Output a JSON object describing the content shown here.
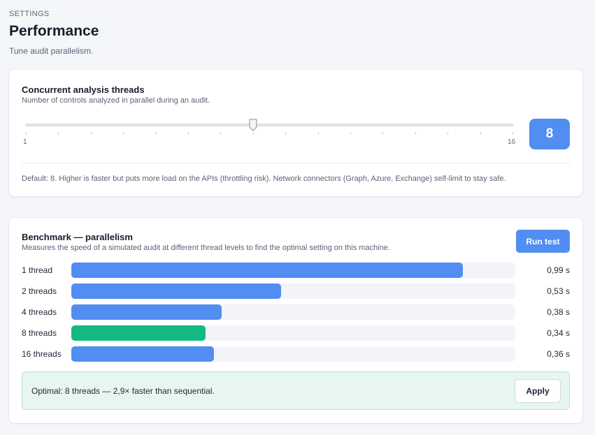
{
  "header": {
    "eyebrow": "SETTINGS",
    "title": "Performance",
    "subtitle": "Tune audit parallelism."
  },
  "threads_card": {
    "title": "Concurrent analysis threads",
    "description": "Number of controls analyzed in parallel during an audit.",
    "slider": {
      "min": 1,
      "max": 16,
      "value": 8,
      "min_label": "1",
      "max_label": "16"
    },
    "value_display": "8",
    "hint": "Default: 8. Higher is faster but puts more load on the APIs (throttling risk). Network connectors (Graph, Azure, Exchange) self-limit to stay safe."
  },
  "benchmark_card": {
    "title": "Benchmark — parallelism",
    "description": "Measures the speed of a simulated audit at different thread levels to find the optimal setting on this machine.",
    "run_button": "Run test",
    "rows": [
      {
        "label": "1 thread",
        "time": "0,99 s",
        "seconds": 0.99,
        "optimal": false
      },
      {
        "label": "2 threads",
        "time": "0,53 s",
        "seconds": 0.53,
        "optimal": false
      },
      {
        "label": "4 threads",
        "time": "0,38 s",
        "seconds": 0.38,
        "optimal": false
      },
      {
        "label": "8 threads",
        "time": "0,34 s",
        "seconds": 0.34,
        "optimal": true
      },
      {
        "label": "16 threads",
        "time": "0,36 s",
        "seconds": 0.36,
        "optimal": false
      }
    ],
    "optimal_text": "Optimal: 8 threads — 2,9× faster than sequential.",
    "apply_button": "Apply"
  },
  "colors": {
    "accent": "#528df2",
    "optimal": "#14b981",
    "track": "#f2f4f8",
    "optimal_bg": "#e7f6ef"
  }
}
